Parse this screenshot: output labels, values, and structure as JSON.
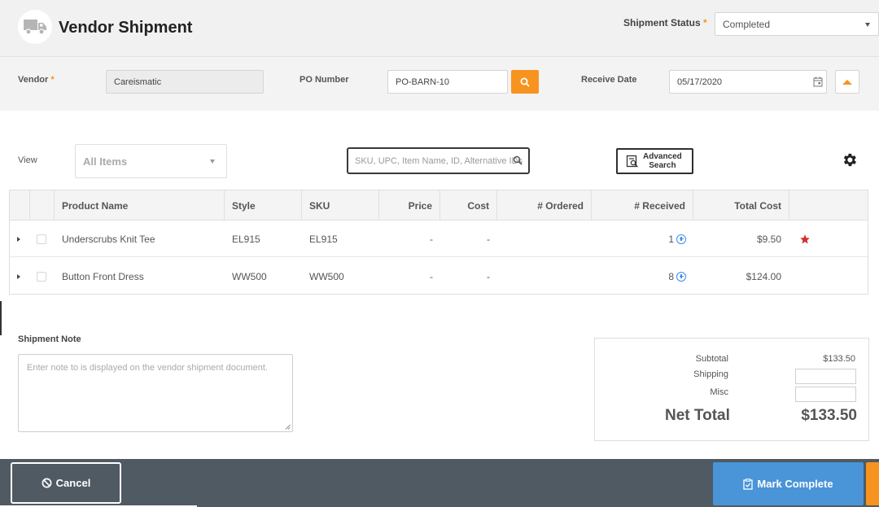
{
  "header": {
    "title": "Vendor Shipment",
    "status_label": "Shipment Status",
    "required_mark": "*",
    "status_value": "Completed"
  },
  "form": {
    "vendor_label": "Vendor",
    "vendor_value": "Careismatic",
    "po_label": "PO Number",
    "po_value": "PO-BARN-10",
    "receive_date_label": "Receive Date",
    "receive_date_value": "05/17/2020"
  },
  "toolbar": {
    "view_label": "View",
    "view_value": "All Items",
    "search_placeholder": "SKU, UPC, Item Name, ID, Alternative IDs",
    "advanced_search_line1": "Advanced",
    "advanced_search_line2": "Search"
  },
  "table": {
    "columns": [
      "Product Name",
      "Style",
      "SKU",
      "Price",
      "Cost",
      "# Ordered",
      "# Received",
      "Total Cost"
    ],
    "rows": [
      {
        "product": "Underscrubs Knit Tee",
        "style": "EL915",
        "sku": "EL915",
        "price": "-",
        "cost": "-",
        "ordered": "",
        "received": "1",
        "total": "$9.50",
        "starred": true
      },
      {
        "product": "Button Front Dress",
        "style": "WW500",
        "sku": "WW500",
        "price": "-",
        "cost": "-",
        "ordered": "",
        "received": "8",
        "total": "$124.00",
        "starred": false
      }
    ]
  },
  "note": {
    "label": "Shipment Note",
    "placeholder": "Enter note to is displayed on the vendor shipment document."
  },
  "summary": {
    "subtotal_label": "Subtotal",
    "subtotal_value": "$133.50",
    "shipping_label": "Shipping",
    "misc_label": "Misc",
    "net_total_label": "Net Total",
    "net_total_value": "$133.50"
  },
  "footer": {
    "cancel_label": "Cancel",
    "mark_complete_label": "Mark Complete"
  },
  "colors": {
    "accent": "#f7931e",
    "primary_button": "#4a94d8",
    "footer_bg": "#505a63",
    "star": "#d32f2f",
    "link_blue": "#3a8ee6"
  }
}
